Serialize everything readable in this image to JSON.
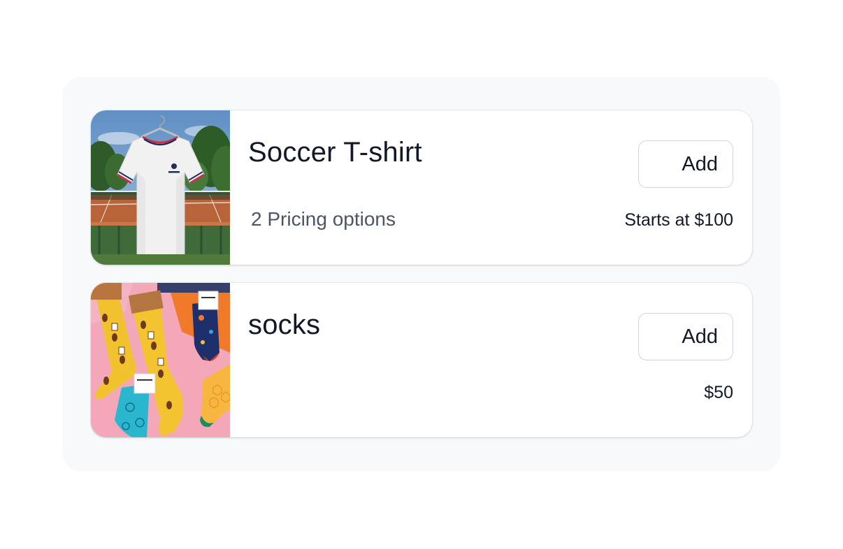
{
  "products": [
    {
      "name": "Soccer T-shirt",
      "options": "2 Pricing options",
      "action": "Add",
      "price": "Starts at $100",
      "image_icon": "tshirt-photo"
    },
    {
      "name": "socks",
      "options": "",
      "action": "Add",
      "price": "$50",
      "image_icon": "socks-photo"
    }
  ],
  "colors": {
    "panel_bg": "#f8f9fb",
    "card_bg": "#ffffff",
    "title_text": "#111827",
    "muted_text": "#4b5563",
    "button_border": "#d1d5db"
  }
}
